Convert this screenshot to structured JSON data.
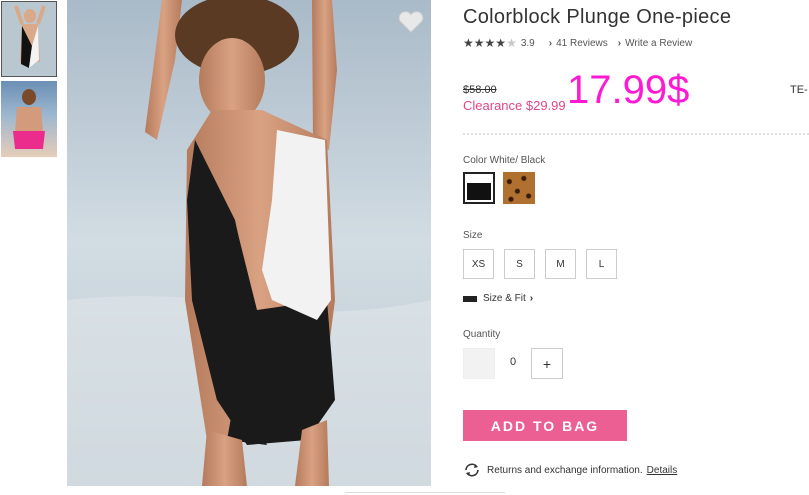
{
  "product": {
    "title": "Colorblock Plunge One-piece",
    "rating": "3.9",
    "reviews_link": "41 Reviews",
    "write_review_link": "Write a Review",
    "original_price": "$58.00",
    "clearance_price": "Clearance $29.99",
    "overlay_price": "17.99$",
    "sku_fragment": "TE-"
  },
  "color": {
    "label": "Color White/ Black",
    "swatches": [
      "white-black",
      "leopard"
    ]
  },
  "size": {
    "label": "Size",
    "options": [
      "XS",
      "S",
      "M",
      "L"
    ],
    "size_fit_link": "Size & Fit"
  },
  "quantity": {
    "label": "Quantity",
    "value": "0",
    "plus_label": "+"
  },
  "actions": {
    "add_to_bag": "ADD TO BAG"
  },
  "returns": {
    "text": "Returns and exchange information.",
    "details_link": "Details"
  },
  "colors": {
    "accent_pink": "#ec5f93",
    "clearance_pink": "#e0468a",
    "overlay_magenta": "#ff19d4"
  },
  "icons": [
    "heart-icon",
    "star-icon",
    "chevron-right-icon",
    "ruler-icon",
    "refresh-icon"
  ]
}
